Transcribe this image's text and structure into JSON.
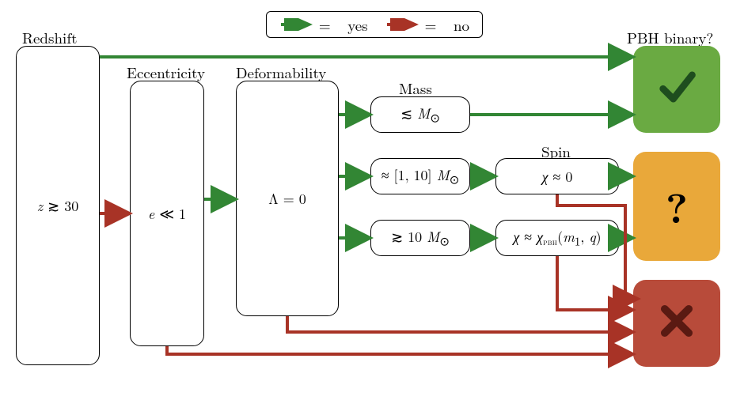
{
  "title": "PBH binary?",
  "legend": {
    "yes": "yes",
    "no": "no",
    "eq": "="
  },
  "colors": {
    "green": "#328634",
    "red": "#a83326",
    "result_yes": "#6aaa42",
    "result_maybe": "#e9a83a",
    "result_no": "#b84b3a"
  },
  "labels": {
    "redshift": "Redshift",
    "eccentricity": "Eccentricity",
    "deformability": "Deformability",
    "mass": "Mass",
    "spin": "Spin",
    "title": "PBH binary?"
  },
  "nodes": {
    "redshift": "z ≳ 30",
    "eccentricity": "e ≪ 1",
    "deformability": "Λ = 0",
    "mass_low": "≲ M⊙",
    "mass_mid": "≈ [1, 10] M⊙",
    "mass_high": "≳ 10 M⊙",
    "spin_zero": "χ ≈ 0",
    "spin_pbh": "χ ≈ χPBH(m₁, q)"
  },
  "results": {
    "yes": "✓",
    "maybe": "?",
    "no": "✗"
  },
  "flow_edges": [
    {
      "from": "redshift",
      "to": "result_yes",
      "answer": "yes"
    },
    {
      "from": "redshift",
      "to": "eccentricity",
      "answer": "no"
    },
    {
      "from": "eccentricity",
      "to": "deformability",
      "answer": "yes"
    },
    {
      "from": "eccentricity",
      "to": "result_no",
      "answer": "no"
    },
    {
      "from": "deformability",
      "to": "mass_low",
      "answer": "yes"
    },
    {
      "from": "deformability",
      "to": "mass_mid",
      "answer": "yes"
    },
    {
      "from": "deformability",
      "to": "mass_high",
      "answer": "yes"
    },
    {
      "from": "deformability",
      "to": "result_no",
      "answer": "no"
    },
    {
      "from": "mass_low",
      "to": "result_yes",
      "answer": "yes"
    },
    {
      "from": "mass_mid",
      "to": "spin_zero",
      "answer": "yes"
    },
    {
      "from": "mass_high",
      "to": "spin_pbh",
      "answer": "yes"
    },
    {
      "from": "spin_zero",
      "to": "result_maybe",
      "answer": "yes"
    },
    {
      "from": "spin_zero",
      "to": "result_no",
      "answer": "no"
    },
    {
      "from": "spin_pbh",
      "to": "result_maybe",
      "answer": "yes"
    },
    {
      "from": "spin_pbh",
      "to": "result_no",
      "answer": "no"
    }
  ]
}
